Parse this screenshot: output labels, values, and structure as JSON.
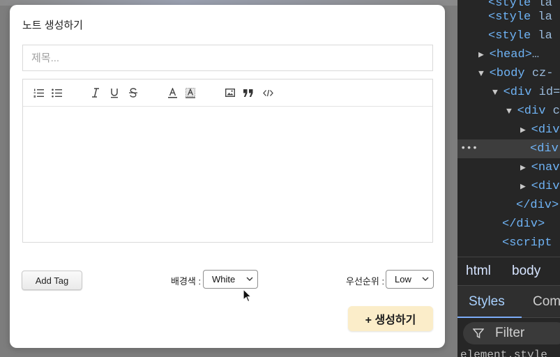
{
  "modal": {
    "title": "노트 생성하기",
    "title_placeholder": "제목...",
    "toolbar_icons": [
      "ordered-list-icon",
      "bullet-list-icon",
      "italic-icon",
      "underline-icon",
      "strikethrough-icon",
      "text-color-icon",
      "highlight-icon",
      "image-icon",
      "blockquote-icon",
      "code-icon"
    ],
    "add_tag_label": "Add Tag",
    "bg_color_label": "배경색 :",
    "bg_color_value": "White",
    "priority_label": "우선순위 :",
    "priority_value": "Low",
    "create_label": "+ 생성하기",
    "create_color": "#fbedc9"
  },
  "devtools": {
    "dom_lines": [
      {
        "caret": "",
        "tag": "<style",
        "rest": " la"
      },
      {
        "caret": "",
        "tag": "<style",
        "rest": " la"
      },
      {
        "caret": "",
        "tag": "<style",
        "rest": " la"
      },
      {
        "caret": "▶",
        "tag": "<head>",
        "rest": "…"
      },
      {
        "caret": "▼",
        "tag": "<body",
        "rest": " cz-"
      },
      {
        "caret": "▼",
        "tag": "<div",
        "rest": " id="
      },
      {
        "caret": "▼",
        "tag": "<div",
        "rest": " c"
      },
      {
        "caret": "▶",
        "tag": "<div",
        "rest": ""
      },
      {
        "caret": "",
        "tag": "<div",
        "rest": ""
      },
      {
        "caret": "▶",
        "tag": "<nav",
        "rest": ""
      },
      {
        "caret": "▶",
        "tag": "<div",
        "rest": ""
      },
      {
        "caret": "",
        "tag": "</div>",
        "rest": ""
      },
      {
        "caret": "",
        "tag": "</div>",
        "rest": ""
      },
      {
        "caret": "",
        "tag": "<script",
        "rest": ""
      }
    ],
    "selected_gutter": "•••",
    "breadcrumbs": [
      "html",
      "body"
    ],
    "tabs": [
      "Styles",
      "Com"
    ],
    "filter_label": "Filter",
    "cut_text": "element.style"
  }
}
